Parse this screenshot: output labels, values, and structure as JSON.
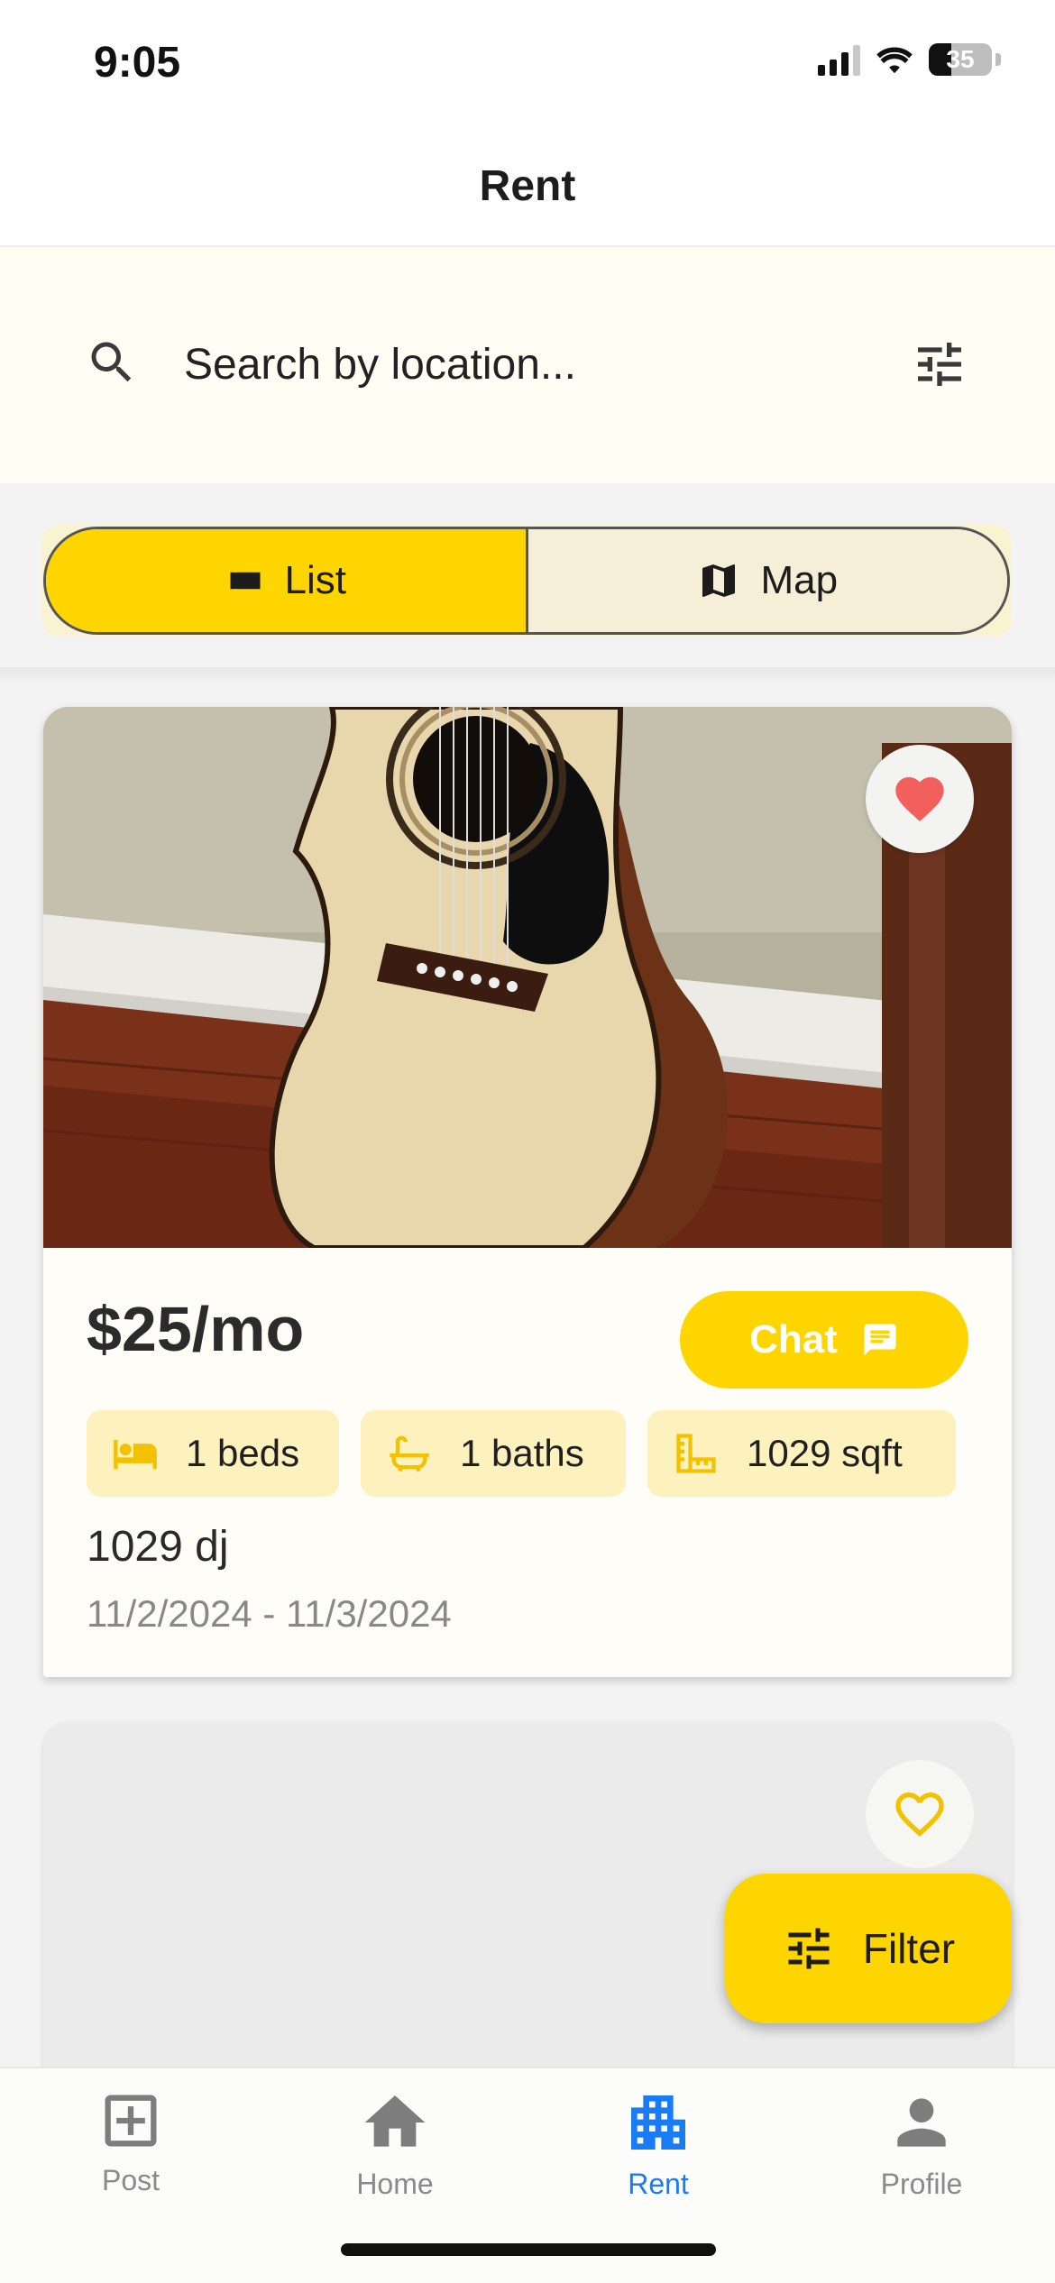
{
  "status_bar": {
    "time": "9:05",
    "battery": "35"
  },
  "header": {
    "title": "Rent"
  },
  "search": {
    "placeholder": "Search by location..."
  },
  "view_toggle": {
    "list_label": "List",
    "map_label": "Map",
    "selected": "List"
  },
  "listings": [
    {
      "price": "$25/mo",
      "chat_label": "Chat",
      "beds": "1 beds",
      "baths": "1 baths",
      "sqft": "1029 sqft",
      "address": "1029 dj",
      "dates": "11/2/2024 - 11/3/2024",
      "favorited": true,
      "image": "acoustic-guitar-photo"
    },
    {
      "favorited": false
    }
  ],
  "fab": {
    "label": "Filter"
  },
  "bottom_nav": [
    {
      "label": "Post",
      "icon": "add-box-icon",
      "active": false
    },
    {
      "label": "Home",
      "icon": "home-icon",
      "active": false
    },
    {
      "label": "Rent",
      "icon": "apartment-icon",
      "active": true
    },
    {
      "label": "Profile",
      "icon": "person-icon",
      "active": false
    }
  ],
  "colors": {
    "accent_yellow": "#ffd500",
    "active_nav_blue": "#1a7cf5",
    "favorite_red": "#f25f5c",
    "chip_bg": "#fdf2bd"
  }
}
